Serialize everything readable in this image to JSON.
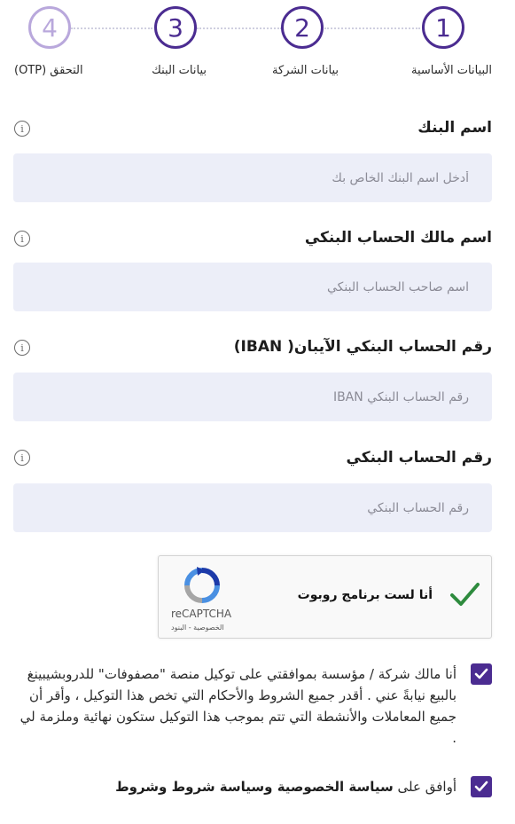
{
  "stepper": {
    "steps": [
      {
        "number": "1",
        "label": "البيانات الأساسية",
        "state": "active"
      },
      {
        "number": "2",
        "label": "بيانات الشركة",
        "state": "active"
      },
      {
        "number": "3",
        "label": "بيانات البنك",
        "state": "active"
      },
      {
        "number": "4",
        "label": "التحقق (OTP)",
        "state": "inactive"
      }
    ],
    "active_color": "#4b2c91",
    "inactive_color": "#b9a8dc"
  },
  "fields": {
    "bank_name": {
      "label": "اسم البنك",
      "placeholder": "أدخل اسم البنك الخاص بك",
      "value": ""
    },
    "account_holder": {
      "label": "اسم مالك الحساب البنكي",
      "placeholder": "اسم صاحب الحساب البنكي",
      "value": ""
    },
    "iban": {
      "label": "رقم الحساب البنكي الآيبان( IBAN)",
      "placeholder": "رقم الحساب البنكي IBAN",
      "value": ""
    },
    "account_number": {
      "label": "رقم الحساب البنكي",
      "placeholder": "رقم الحساب البنكي",
      "value": ""
    }
  },
  "recaptcha": {
    "label": "أنا لست برنامج روبوت",
    "brand": "reCAPTCHA",
    "links": "الخصوصية - البنود",
    "checked": true
  },
  "agreements": {
    "authorization": {
      "text": "أنا مالك شركة / مؤسسة بموافقتي على توكيل منصة \"مصفوفات\" للدروبشيبينغ بالبيع نيابةً عني . أقدر جميع الشروط والأحكام التي تخص هذا التوكيل ، وأقر أن جميع المعاملات والأنشطة التي تتم بموجب هذا التوكيل ستكون نهائية وملزمة لي .",
      "checked": true
    },
    "privacy": {
      "prefix": "أوافق على",
      "link": "سياسة الخصوصية وسياسة شروط وشروط",
      "checked": true
    }
  },
  "colors": {
    "brand": "#4b2c91",
    "input_bg": "#eceef8",
    "check_green": "#2e7d32"
  }
}
